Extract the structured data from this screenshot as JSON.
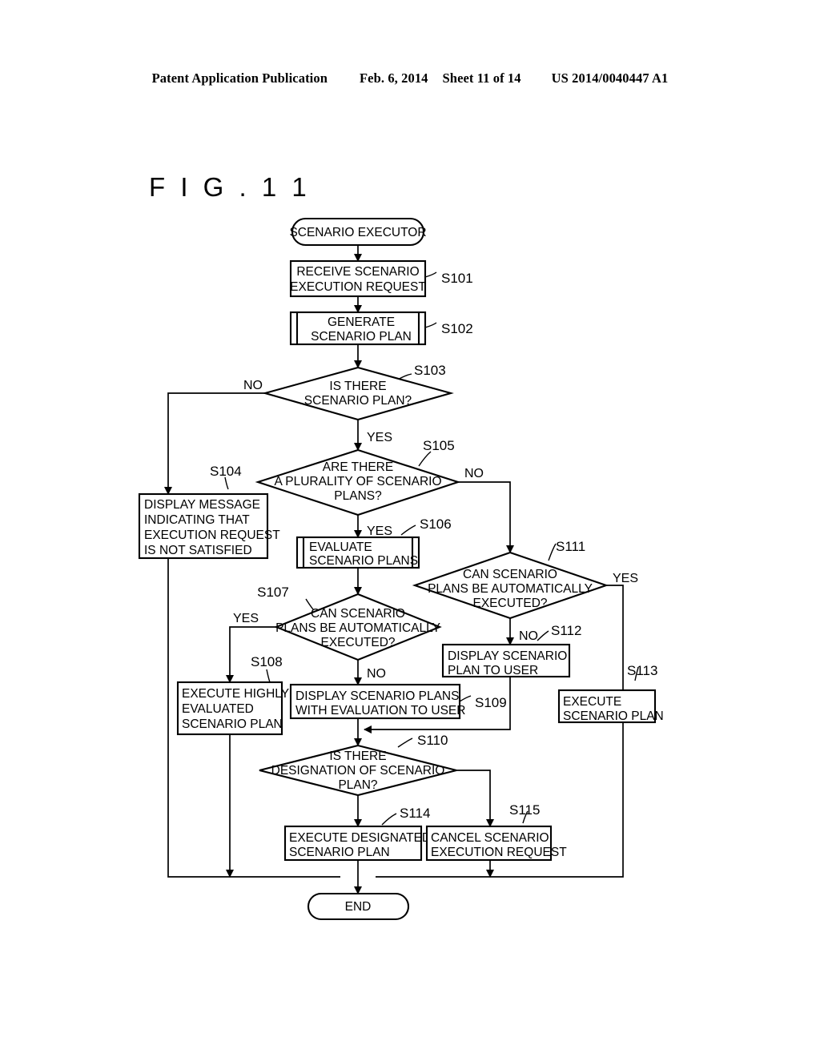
{
  "header": {
    "publication": "Patent Application Publication",
    "date": "Feb. 6, 2014",
    "sheet": "Sheet 11 of 14",
    "number": "US 2014/0040447 A1"
  },
  "figure": {
    "title": "F I G . 1 1"
  },
  "chart_data": {
    "type": "diagram",
    "diagram_type": "flowchart",
    "title": "FIG.11",
    "nodes": [
      {
        "id": "start",
        "shape": "terminal",
        "step": "",
        "lines": [
          "SCENARIO EXECUTOR"
        ]
      },
      {
        "id": "s101",
        "shape": "process",
        "step": "S101",
        "lines": [
          "RECEIVE SCENARIO",
          "EXECUTION REQUEST"
        ]
      },
      {
        "id": "s102",
        "shape": "predefined-process",
        "step": "S102",
        "lines": [
          "GENERATE",
          "SCENARIO PLAN"
        ]
      },
      {
        "id": "s103",
        "shape": "decision",
        "step": "S103",
        "lines": [
          "IS THERE",
          "SCENARIO PLAN?"
        ]
      },
      {
        "id": "s104",
        "shape": "process",
        "step": "S104",
        "lines": [
          "DISPLAY MESSAGE",
          "INDICATING THAT",
          "EXECUTION REQUEST",
          "IS NOT SATISFIED"
        ]
      },
      {
        "id": "s105",
        "shape": "decision",
        "step": "S105",
        "lines": [
          "ARE THERE",
          "A PLURALITY OF SCENARIO",
          "PLANS?"
        ]
      },
      {
        "id": "s106",
        "shape": "predefined-process",
        "step": "S106",
        "lines": [
          "EVALUATE",
          "SCENARIO PLANS"
        ]
      },
      {
        "id": "s107",
        "shape": "decision",
        "step": "S107",
        "lines": [
          "CAN SCENARIO",
          "PLANS BE AUTOMATICALLY",
          "EXECUTED?"
        ]
      },
      {
        "id": "s108",
        "shape": "process",
        "step": "S108",
        "lines": [
          "EXECUTE HIGHLY",
          "EVALUATED",
          "SCENARIO PLAN"
        ]
      },
      {
        "id": "s109",
        "shape": "process",
        "step": "S109",
        "lines": [
          "DISPLAY SCENARIO PLANS",
          "WITH EVALUATION TO USER"
        ]
      },
      {
        "id": "s110",
        "shape": "decision",
        "step": "S110",
        "lines": [
          "IS THERE",
          "DESIGNATION OF SCENARIO",
          "PLAN?"
        ]
      },
      {
        "id": "s111",
        "shape": "decision",
        "step": "S111",
        "lines": [
          "CAN SCENARIO",
          "PLANS BE AUTOMATICALLY",
          "EXECUTED?"
        ]
      },
      {
        "id": "s112",
        "shape": "process",
        "step": "S112",
        "lines": [
          "DISPLAY SCENARIO",
          "PLAN TO USER"
        ]
      },
      {
        "id": "s113",
        "shape": "process",
        "step": "S113",
        "lines": [
          "EXECUTE",
          "SCENARIO PLAN"
        ]
      },
      {
        "id": "s114",
        "shape": "process",
        "step": "S114",
        "lines": [
          "EXECUTE DESIGNATED",
          "SCENARIO PLAN"
        ]
      },
      {
        "id": "s115",
        "shape": "process",
        "step": "S115",
        "lines": [
          "CANCEL SCENARIO",
          "EXECUTION REQUEST"
        ]
      },
      {
        "id": "end",
        "shape": "terminal",
        "step": "",
        "lines": [
          "END"
        ]
      }
    ],
    "edge_labels": {
      "s103_no": "NO",
      "s103_yes": "YES",
      "s105_no": "NO",
      "s105_yes": "YES",
      "s107_yes": "YES",
      "s107_no": "NO",
      "s111_yes": "YES",
      "s111_no": "NO"
    },
    "edges": [
      {
        "from": "start",
        "to": "s101",
        "label": ""
      },
      {
        "from": "s101",
        "to": "s102",
        "label": ""
      },
      {
        "from": "s102",
        "to": "s103",
        "label": ""
      },
      {
        "from": "s103",
        "to": "s104",
        "label": "NO"
      },
      {
        "from": "s103",
        "to": "s105",
        "label": "YES"
      },
      {
        "from": "s105",
        "to": "s111",
        "label": "NO"
      },
      {
        "from": "s105",
        "to": "s106",
        "label": "YES"
      },
      {
        "from": "s106",
        "to": "s107",
        "label": ""
      },
      {
        "from": "s107",
        "to": "s108",
        "label": "YES"
      },
      {
        "from": "s107",
        "to": "s109",
        "label": "NO"
      },
      {
        "from": "s109",
        "to": "s110",
        "label": ""
      },
      {
        "from": "s110",
        "to": "s114",
        "label": ""
      },
      {
        "from": "s110",
        "to": "s115",
        "label": ""
      },
      {
        "from": "s111",
        "to": "s113",
        "label": "YES"
      },
      {
        "from": "s111",
        "to": "s112",
        "label": "NO"
      },
      {
        "from": "s112",
        "to": "s110",
        "label": ""
      },
      {
        "from": "s104",
        "to": "end",
        "label": ""
      },
      {
        "from": "s108",
        "to": "end",
        "label": ""
      },
      {
        "from": "s113",
        "to": "end",
        "label": ""
      },
      {
        "from": "s114",
        "to": "end",
        "label": ""
      },
      {
        "from": "s115",
        "to": "end",
        "label": ""
      }
    ]
  }
}
